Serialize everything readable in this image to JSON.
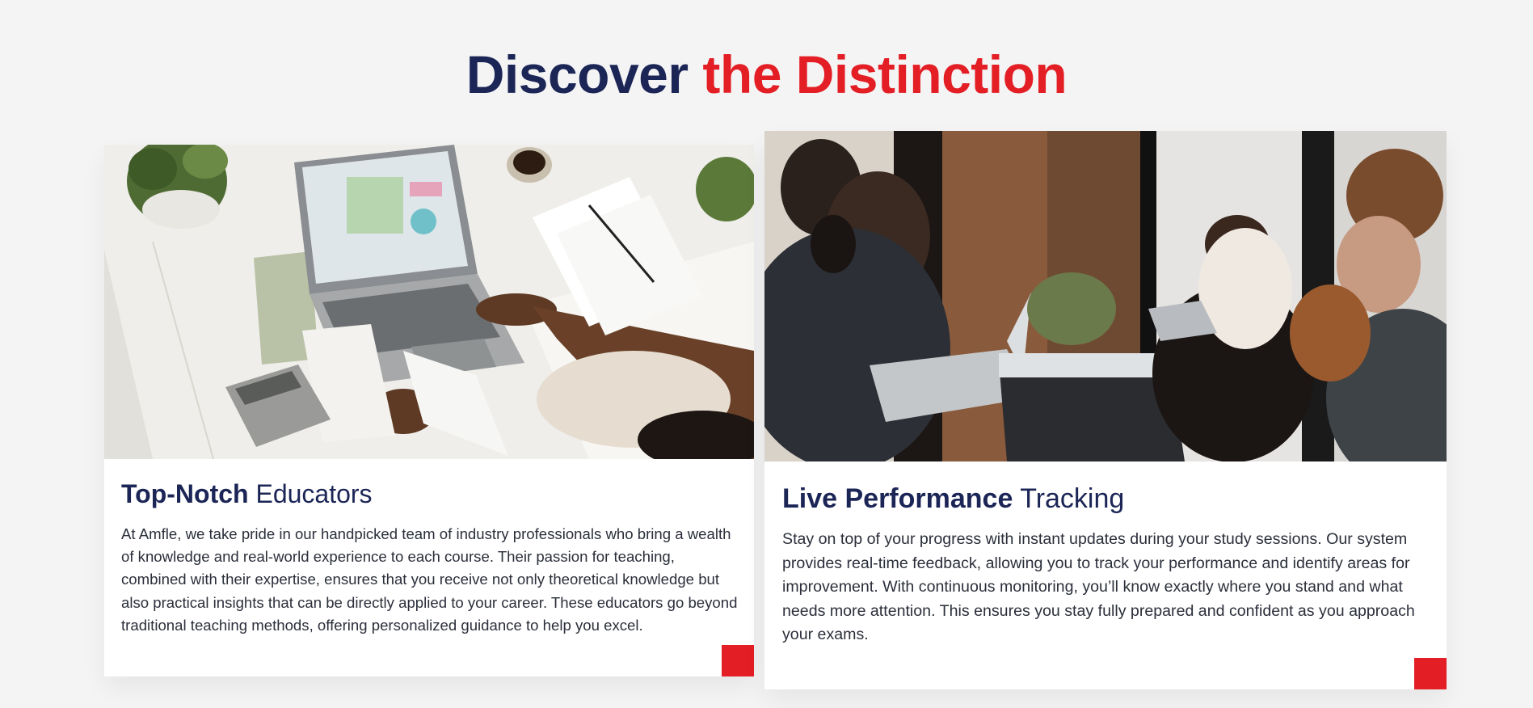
{
  "heading": {
    "part1": "Discover ",
    "part2": "the Distinction"
  },
  "cards": [
    {
      "title_strong": "Top-Notch",
      "title_rest": " Educators",
      "text": "At Amfle, we take pride in our handpicked team of industry professionals who bring a wealth of knowledge and real-world experience to each course. Their passion for teaching, combined with their expertise, ensures that you receive not only theoretical knowledge but also practical insights that can be directly applied to your career. These educators go beyond traditional teaching methods, offering personalized guidance to help you excel."
    },
    {
      "title_strong": "Live Performance",
      "title_rest": " Tracking",
      "text": "Stay on top of your progress with instant updates during your study sessions. Our system provides real-time feedback, allowing you to track your performance and identify areas for improvement. With continuous monitoring, you’ll know exactly where you stand and what needs more attention. This ensures you stay fully prepared and confident as you approach your exams."
    }
  ],
  "colors": {
    "navy": "#1b2556",
    "red": "#e31e24",
    "page_background": "#f4f4f5"
  }
}
